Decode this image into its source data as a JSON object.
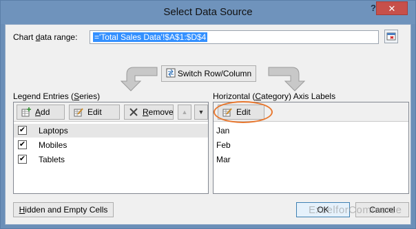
{
  "window": {
    "title": "Select Data Source",
    "help_label": "?",
    "close_label": "✕"
  },
  "range": {
    "label_pre": "Chart ",
    "label_ul": "d",
    "label_post": "ata range:",
    "value": "='Total Sales Data'!$A$1:$D$4"
  },
  "switch": {
    "label_pre": "",
    "label_ul": "W",
    "label_post": "Switch Row/Column"
  },
  "legend": {
    "heading_pre": "Legend Entries (",
    "heading_ul": "S",
    "heading_post": "eries)",
    "add_ul": "A",
    "add_rest": "dd",
    "edit_label": "Edit",
    "remove_ul": "R",
    "remove_rest": "emove",
    "up_glyph": "▲",
    "down_glyph": "▼",
    "items": [
      {
        "label": "Laptops",
        "checked": "✔"
      },
      {
        "label": "Mobiles",
        "checked": "✔"
      },
      {
        "label": "Tablets",
        "checked": "✔"
      }
    ]
  },
  "axis": {
    "heading_pre": "Horizontal (",
    "heading_ul": "C",
    "heading_post": "ategory) Axis Labels",
    "edit_ul": "T",
    "edit_label": "Edit",
    "items": [
      "Jan",
      "Feb",
      "Mar"
    ]
  },
  "footer": {
    "hidden_ul": "H",
    "hidden_rest": "idden and Empty Cells",
    "ok_label": "OK",
    "cancel_label": "Cancel",
    "watermark": "ExcelforCommerce"
  },
  "colors": {
    "titlebar": "#6f93bc",
    "close": "#c7504a",
    "highlight": "#e8772e",
    "selection": "#3390ff"
  }
}
